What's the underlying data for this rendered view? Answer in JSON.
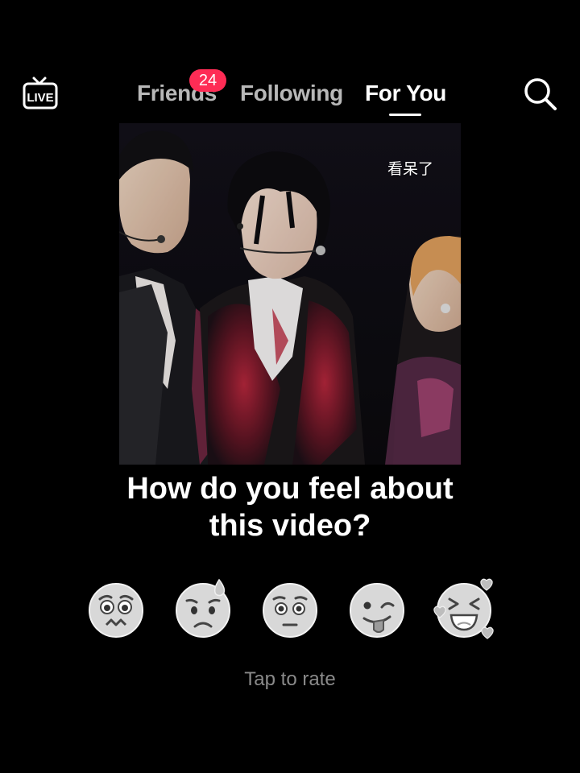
{
  "nav": {
    "live_label": "LIVE",
    "tabs": [
      {
        "label": "Friends",
        "badge": "24",
        "active": false
      },
      {
        "label": "Following",
        "active": false
      },
      {
        "label": "For You",
        "active": true
      }
    ]
  },
  "video": {
    "caption": "看呆了"
  },
  "prompt": {
    "line1": "How do you feel about",
    "line2": "this video?"
  },
  "rating": {
    "options": [
      {
        "icon": "pleading-face-icon"
      },
      {
        "icon": "sad-sweat-face-icon"
      },
      {
        "icon": "flushed-face-icon"
      },
      {
        "icon": "winking-tongue-face-icon"
      },
      {
        "icon": "laughing-hearts-face-icon"
      }
    ],
    "hint": "Tap to rate"
  },
  "colors": {
    "background": "#000000",
    "badge": "#fe2c55",
    "text": "#ffffff",
    "muted": "#8a8a8a",
    "emoji_face": "#d8d8d8"
  }
}
